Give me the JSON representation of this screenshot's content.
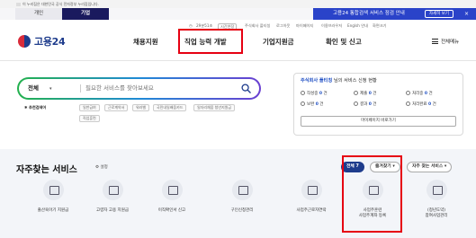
{
  "gov_banner": {
    "text": "이 누리집은 대한민국 공식 전자정부 누리집입니다."
  },
  "user_tabs": [
    {
      "label": "개인"
    },
    {
      "label": "기업"
    }
  ],
  "promo": {
    "text": "고용24 통합검색 서비스 점검 안내",
    "button": "자세히 보기",
    "close": "×"
  },
  "util_bar": {
    "timer": "29분51초",
    "extend": "시간연장",
    "company": "주식회사 플티칭",
    "logout": "로그아웃",
    "mypage": "마이페이지",
    "browser": "이용브라우저",
    "language": "Englsh 안내",
    "size": "화면크기"
  },
  "logo": {
    "text": "고용24"
  },
  "gnb": [
    {
      "label": "채용지원"
    },
    {
      "label": "직업 능력 개발"
    },
    {
      "label": "기업지원금"
    },
    {
      "label": "확인 및 신고"
    }
  ],
  "all_menu": "전체메뉴",
  "search": {
    "scope": "전체",
    "placeholder": "필요한 서비스를 찾아보세요"
  },
  "recommend": {
    "label": "추천검색어",
    "keywords": [
      "일반급여",
      "근로계약서",
      "워라밸",
      "국민내일배움카드",
      "일자리채움 청년지원금",
      "직업훈련"
    ]
  },
  "status": {
    "company": "주식회사 플티칭",
    "title_suffix": " 님의 서비스 신청 현황",
    "items": [
      {
        "label": "작성중",
        "value": "0",
        "unit": "건"
      },
      {
        "label": "제출",
        "value": "0",
        "unit": "건"
      },
      {
        "label": "처리중",
        "value": "0",
        "unit": "건"
      },
      {
        "label": "보완",
        "value": "0",
        "unit": "건"
      },
      {
        "label": "결과",
        "value": "0",
        "unit": "건"
      },
      {
        "label": "처리완료",
        "value": "0",
        "unit": "건"
      }
    ],
    "mypage_button": "마이페이지 바로가기"
  },
  "frequent": {
    "title": "자주찾는 서비스",
    "setting": "설정",
    "filters": [
      {
        "label": "전체 7"
      },
      {
        "label": "즐겨찾기 ▾"
      },
      {
        "label": "자주 찾는 서비스 ▾"
      }
    ],
    "services": [
      {
        "label": "출산육아기 지원금"
      },
      {
        "label": "고령자 고용 지원금"
      },
      {
        "label": "이직확인서 신고"
      },
      {
        "label": "구인신청관리"
      },
      {
        "label": "사업주근로자연락"
      },
      {
        "label": "사업주훈련\n사업주계좌 등록"
      },
      {
        "label": "(청년도약)\n참여사업관리"
      }
    ]
  },
  "colors": {
    "brand_navy": "#1e3c8c",
    "promo_blue": "#2a43c9",
    "highlight_red": "#e60012",
    "count_blue": "#1f4fc4"
  }
}
